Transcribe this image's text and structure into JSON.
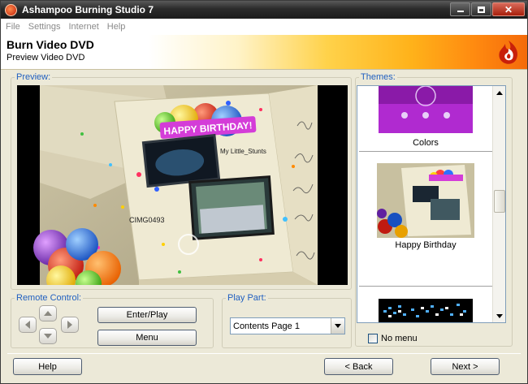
{
  "window": {
    "title": "Ashampoo Burning Studio 7"
  },
  "menu": [
    "File",
    "Settings",
    "Internet",
    "Help"
  ],
  "header": {
    "title": "Burn Video DVD",
    "subtitle": "Preview Video DVD"
  },
  "preview": {
    "label": "Preview:",
    "card_title": "HAPPY BIRTHDAY!",
    "thumb1_caption": "CIMG0493",
    "thumb2_caption": "My Little_Stunts"
  },
  "themes": {
    "label": "Themes:",
    "items": [
      {
        "label": "Colors"
      },
      {
        "label": "Happy Birthday"
      },
      {
        "label": ""
      }
    ],
    "no_menu_label": "No menu",
    "no_menu_checked": false
  },
  "remote_control": {
    "label": "Remote Control:",
    "enter_play_label": "Enter/Play",
    "menu_label": "Menu"
  },
  "play_part": {
    "label": "Play Part:",
    "selected": "Contents Page 1"
  },
  "footer": {
    "help_label": "Help",
    "back_label": "< Back",
    "next_label": "Next >"
  },
  "colors": {
    "accent_orange": "#f46a0a",
    "group_label_blue": "#2160c0",
    "window_bg": "#ece9d8"
  }
}
